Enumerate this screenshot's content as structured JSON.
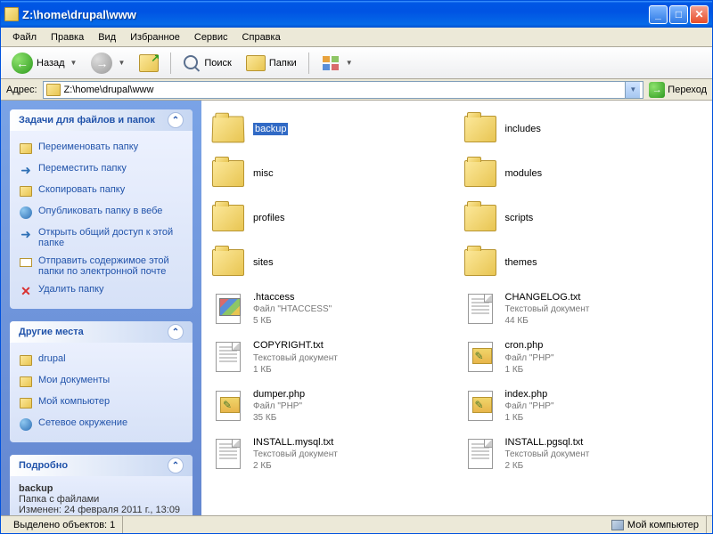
{
  "window": {
    "title": "Z:\\home\\drupal\\www"
  },
  "menu": {
    "file": "Файл",
    "edit": "Правка",
    "view": "Вид",
    "favorites": "Избранное",
    "tools": "Сервис",
    "help": "Справка"
  },
  "toolbar": {
    "back": "Назад",
    "search": "Поиск",
    "folders": "Папки"
  },
  "address": {
    "label": "Адрес:",
    "path": "Z:\\home\\drupal\\www",
    "go": "Переход"
  },
  "panels": {
    "tasks": {
      "title": "Задачи для файлов и папок",
      "items": [
        {
          "label": "Переименовать папку",
          "icon": "folder"
        },
        {
          "label": "Переместить папку",
          "icon": "arrow"
        },
        {
          "label": "Скопировать папку",
          "icon": "folder"
        },
        {
          "label": "Опубликовать папку в вебе",
          "icon": "globe"
        },
        {
          "label": "Открыть общий доступ к этой папке",
          "icon": "arrow"
        },
        {
          "label": "Отправить содержимое этой папки по электронной почте",
          "icon": "mail"
        },
        {
          "label": "Удалить папку",
          "icon": "del"
        }
      ]
    },
    "places": {
      "title": "Другие места",
      "items": [
        {
          "label": "drupal",
          "icon": "folder"
        },
        {
          "label": "Мои документы",
          "icon": "folder"
        },
        {
          "label": "Мой компьютер",
          "icon": "folder"
        },
        {
          "label": "Сетевое окружение",
          "icon": "globe"
        }
      ]
    },
    "details": {
      "title": "Подробно",
      "name": "backup",
      "type": "Папка с файлами",
      "modified": "Изменен: 24 февраля 2011 г., 13:09"
    }
  },
  "files": [
    {
      "name": "backup",
      "type": "folder-open",
      "selected": true
    },
    {
      "name": "includes",
      "type": "folder"
    },
    {
      "name": "misc",
      "type": "folder"
    },
    {
      "name": "modules",
      "type": "folder"
    },
    {
      "name": "profiles",
      "type": "folder"
    },
    {
      "name": "scripts",
      "type": "folder"
    },
    {
      "name": "sites",
      "type": "folder"
    },
    {
      "name": "themes",
      "type": "folder"
    },
    {
      "name": ".htaccess",
      "type": "hta",
      "meta1": "Файл \"HTACCESS\"",
      "meta2": "5 КБ"
    },
    {
      "name": "CHANGELOG.txt",
      "type": "doc",
      "meta1": "Текстовый документ",
      "meta2": "44 КБ"
    },
    {
      "name": "COPYRIGHT.txt",
      "type": "doc",
      "meta1": "Текстовый документ",
      "meta2": "1 КБ"
    },
    {
      "name": "cron.php",
      "type": "php",
      "meta1": "Файл \"PHP\"",
      "meta2": "1 КБ"
    },
    {
      "name": "dumper.php",
      "type": "php",
      "meta1": "Файл \"PHP\"",
      "meta2": "35 КБ"
    },
    {
      "name": "index.php",
      "type": "php",
      "meta1": "Файл \"PHP\"",
      "meta2": "1 КБ"
    },
    {
      "name": "INSTALL.mysql.txt",
      "type": "doc",
      "meta1": "Текстовый документ",
      "meta2": "2 КБ"
    },
    {
      "name": "INSTALL.pgsql.txt",
      "type": "doc",
      "meta1": "Текстовый документ",
      "meta2": "2 КБ"
    }
  ],
  "status": {
    "selection": "Выделено объектов: 1",
    "location": "Мой компьютер"
  }
}
